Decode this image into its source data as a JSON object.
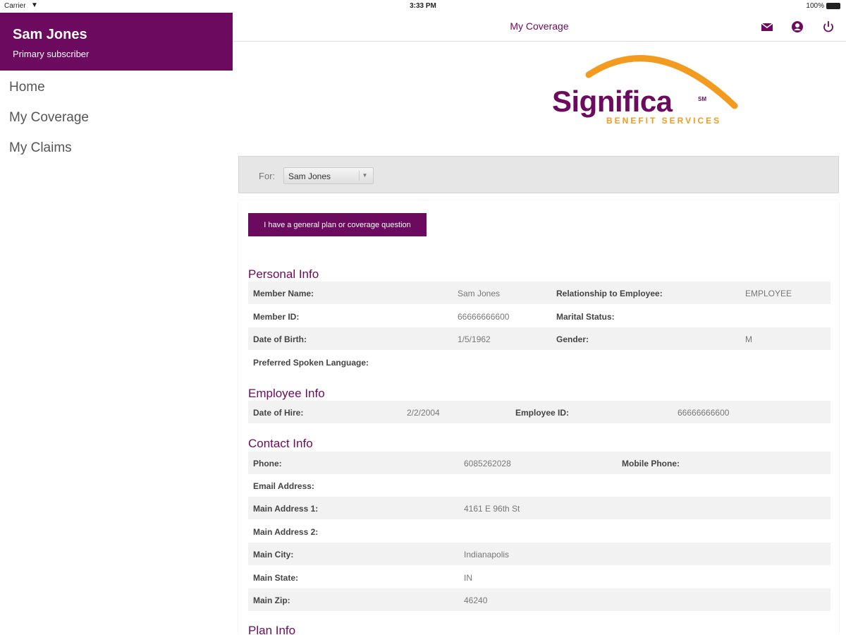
{
  "status_bar": {
    "carrier": "Carrier",
    "time": "3:33 PM",
    "battery": "100%"
  },
  "sidebar": {
    "user_name": "Sam Jones",
    "user_role": "Primary subscriber",
    "items": [
      {
        "label": "Home"
      },
      {
        "label": "My Coverage"
      },
      {
        "label": "My Claims"
      }
    ]
  },
  "header": {
    "title": "My Coverage",
    "icons": [
      "mail-icon",
      "account-icon",
      "power-icon"
    ]
  },
  "logo": {
    "name": "Significa",
    "mark": "SM",
    "tagline": "BENEFIT SERVICES"
  },
  "filter": {
    "label": "For:",
    "selected": "Sam Jones"
  },
  "question_button": "I have a general plan or coverage question",
  "personal_info": {
    "title": "Personal Info",
    "member_name_label": "Member Name:",
    "member_name": "Sam Jones",
    "relationship_label": "Relationship to Employee:",
    "relationship": "EMPLOYEE",
    "member_id_label": "Member ID:",
    "member_id": "66666666600",
    "marital_label": "Marital Status:",
    "marital": "",
    "dob_label": "Date of Birth:",
    "dob": "1/5/1962",
    "gender_label": "Gender:",
    "gender": "M",
    "language_label": "Preferred Spoken Language:",
    "language": ""
  },
  "employee_info": {
    "title": "Employee Info",
    "hire_label": "Date of Hire:",
    "hire": "2/2/2004",
    "emp_id_label": "Employee ID:",
    "emp_id": "66666666600"
  },
  "contact_info": {
    "title": "Contact Info",
    "phone_label": "Phone:",
    "phone": "6085262028",
    "mobile_label": "Mobile Phone:",
    "mobile": "",
    "email_label": "Email Address:",
    "email": "",
    "addr1_label": "Main Address 1:",
    "addr1": "4161 E 96th St",
    "addr2_label": "Main Address 2:",
    "addr2": "",
    "city_label": "Main City:",
    "city": "Indianapolis",
    "state_label": "Main State:",
    "state": "IN",
    "zip_label": "Main Zip:",
    "zip": "46240"
  },
  "plan_info": {
    "title": "Plan Info"
  },
  "colors": {
    "brand_purple": "#6b0a5e",
    "brand_orange": "#f29b1e",
    "row_shade": "#f2f2f2"
  }
}
